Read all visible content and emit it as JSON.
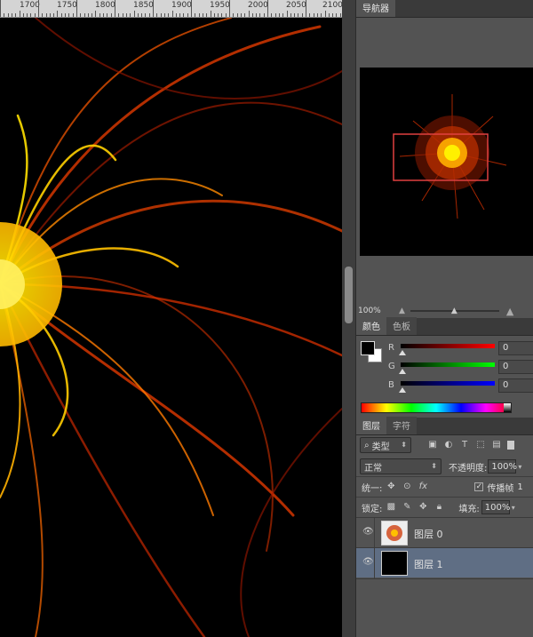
{
  "ruler": {
    "labels": [
      "1700",
      "1750",
      "1800",
      "1850",
      "1900",
      "1950",
      "2000",
      "2050",
      "2100"
    ]
  },
  "navigator": {
    "tab_label": "导航器",
    "zoom": "100%"
  },
  "color_panel": {
    "tabs": [
      "颜色",
      "色板"
    ],
    "channels": [
      {
        "label": "R",
        "value": "0",
        "color": "#c00000"
      },
      {
        "label": "G",
        "value": "0",
        "color": "#00c000"
      },
      {
        "label": "B",
        "value": "0",
        "color": "#0000d0"
      }
    ],
    "foreground": "#000000",
    "background": "#ffffff"
  },
  "layers_panel": {
    "tabs": [
      "图层",
      "字符"
    ],
    "filter_label": "类型",
    "blend_mode": "正常",
    "opacity_label": "不透明度:",
    "opacity_value": "100%",
    "unify_label": "统一:",
    "propagate_label": "传播帧",
    "propagate_suffix": "1",
    "lock_label": "锁定:",
    "fill_label": "填充:",
    "fill_value": "100%",
    "layers": [
      {
        "name": "图层 0",
        "selected": false,
        "thumb": "flower"
      },
      {
        "name": "图层 1",
        "selected": true,
        "thumb": "black"
      }
    ]
  }
}
